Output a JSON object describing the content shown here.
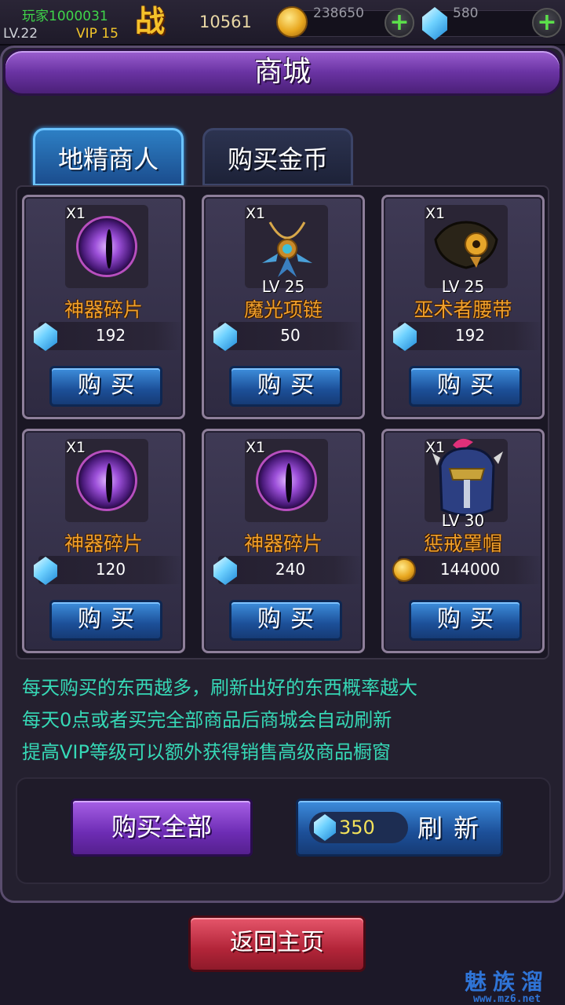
{
  "player": {
    "name": "玩家1000031",
    "level": "LV.22",
    "vip": "VIP 15",
    "battle_icon_char": "战",
    "battle_power": "10561"
  },
  "resources": {
    "gold": "238650",
    "gems": "580",
    "add_symbol": "+"
  },
  "shop": {
    "title": "商城",
    "tabs": [
      {
        "label": "地精商人",
        "active": true
      },
      {
        "label": "购买金币",
        "active": false
      }
    ],
    "items": [
      {
        "qty": "X1",
        "level": "",
        "name": "神器碎片",
        "currency": "gem",
        "price": "192",
        "icon": "purple-eye-orb-icon",
        "buy_label": "购买"
      },
      {
        "qty": "X1",
        "level": "LV 25",
        "name": "魔光项链",
        "currency": "gem",
        "price": "50",
        "icon": "necklace-icon",
        "buy_label": "购买"
      },
      {
        "qty": "X1",
        "level": "LV 25",
        "name": "巫术者腰带",
        "currency": "gem",
        "price": "192",
        "icon": "belt-icon",
        "buy_label": "购买"
      },
      {
        "qty": "X1",
        "level": "",
        "name": "神器碎片",
        "currency": "gem",
        "price": "120",
        "icon": "purple-eye-orb-icon",
        "buy_label": "购买"
      },
      {
        "qty": "X1",
        "level": "",
        "name": "神器碎片",
        "currency": "gem",
        "price": "240",
        "icon": "purple-eye-orb-icon",
        "buy_label": "购买"
      },
      {
        "qty": "X1",
        "level": "LV 30",
        "name": "惩戒罩帽",
        "currency": "gold",
        "price": "144000",
        "icon": "helmet-icon",
        "buy_label": "购买"
      }
    ],
    "info": [
      "每天购买的东西越多，刷新出好的东西概率越大",
      "每天0点或者买完全部商品后商城会自动刷新",
      "提高VIP等级可以额外获得销售高级商品橱窗"
    ],
    "buy_all_label": "购买全部",
    "refresh_cost": "350",
    "refresh_label": "刷新",
    "return_label": "返回主页"
  },
  "watermark": {
    "text": "魅族溜",
    "url": "www.mz6.net"
  },
  "colors": {
    "gem": "#6fd2ff",
    "gold": "#e8a71f",
    "item_name": "#f0a02c",
    "info_text": "#36d8b6",
    "buy_button": "#1c4f98",
    "title_bar": "#6a33a3"
  }
}
